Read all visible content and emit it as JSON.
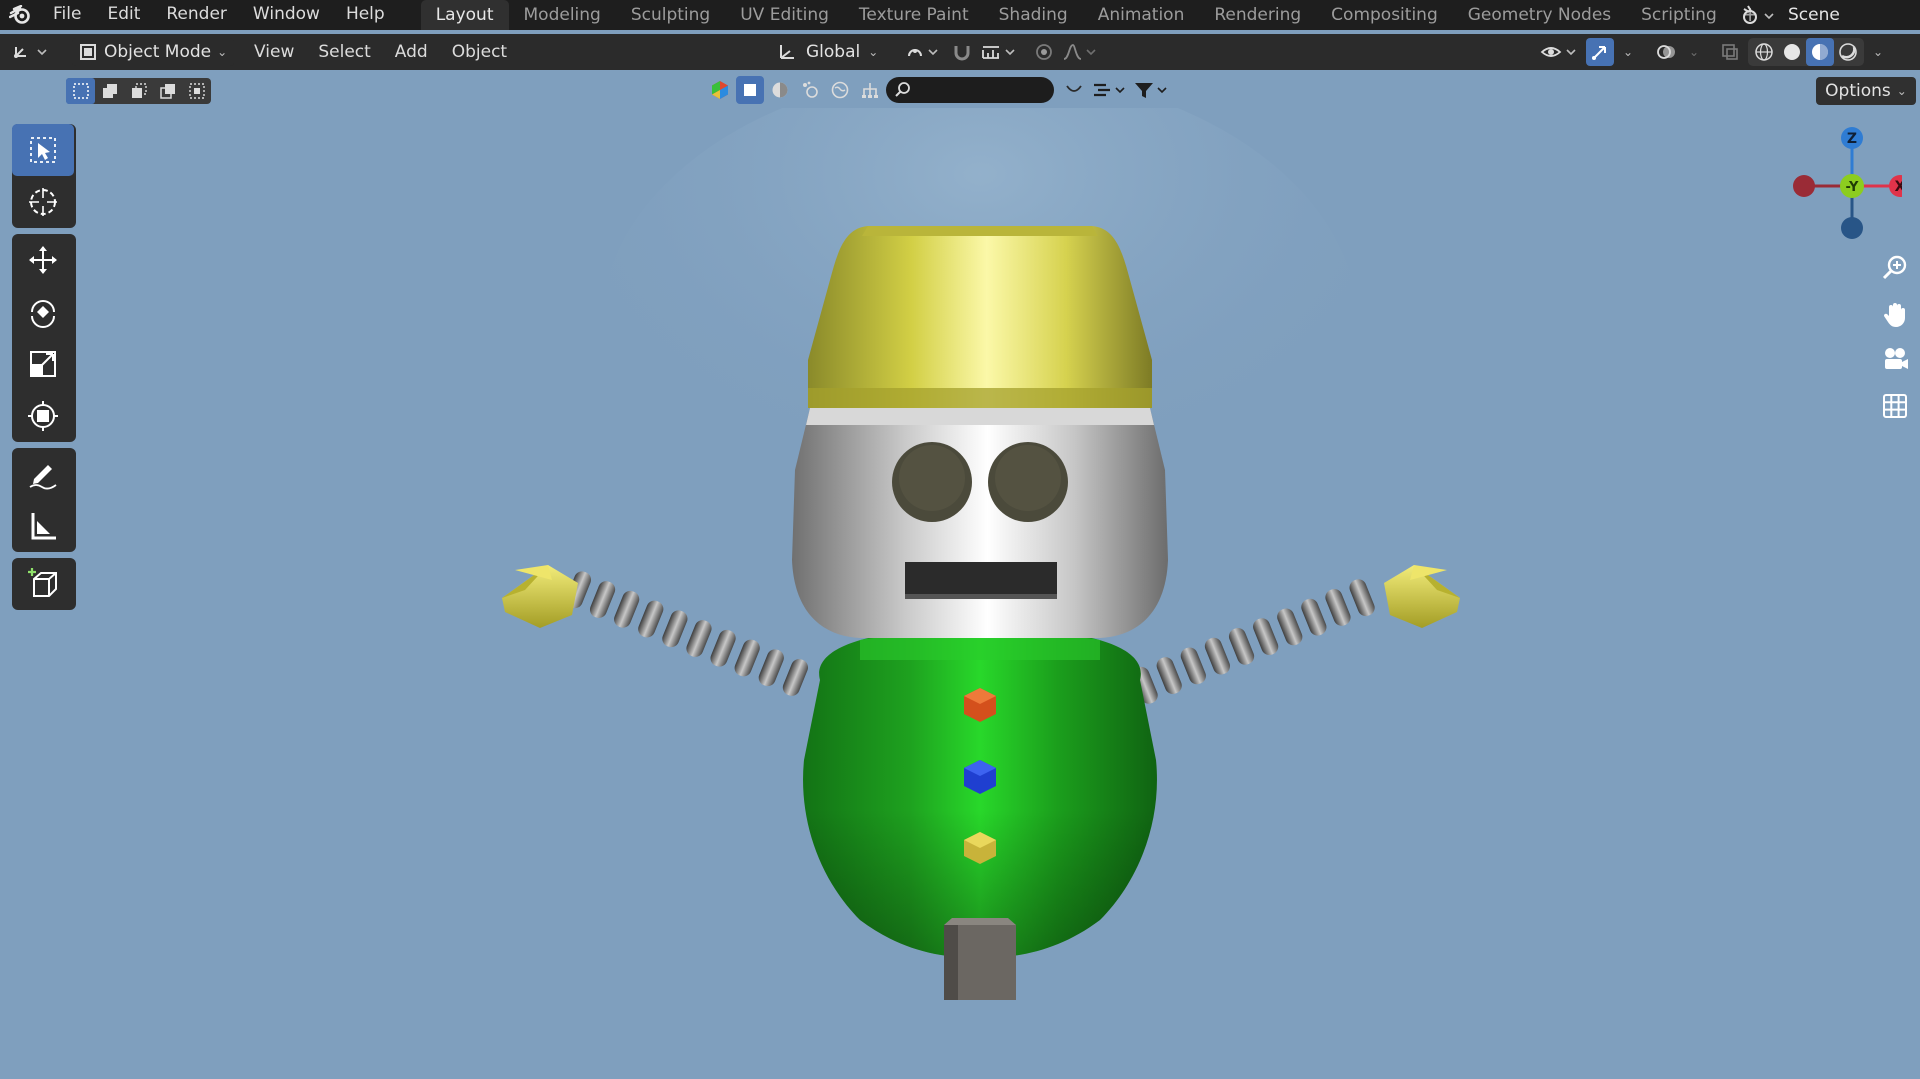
{
  "menu": {
    "items": [
      "File",
      "Edit",
      "Render",
      "Window",
      "Help"
    ]
  },
  "workspaces": {
    "tabs": [
      "Layout",
      "Modeling",
      "Sculpting",
      "UV Editing",
      "Texture Paint",
      "Shading",
      "Animation",
      "Rendering",
      "Compositing",
      "Geometry Nodes",
      "Scripting"
    ],
    "active": "Layout",
    "add_label": "+"
  },
  "scene": {
    "name": "Scene"
  },
  "header": {
    "mode": "Object Mode",
    "menus": [
      "View",
      "Select",
      "Add",
      "Object"
    ],
    "orientation": "Global"
  },
  "toolbar_row": {
    "search_placeholder": "",
    "options_label": "Options"
  },
  "tools": {
    "active": "select-box",
    "items": [
      "select-box",
      "cursor",
      "move",
      "rotate",
      "scale",
      "transform",
      "annotate",
      "measure",
      "add-cube"
    ]
  },
  "gizmo": {
    "z_label": "Z",
    "y_label": "-Y",
    "x_label": "X",
    "colors": {
      "x": "#e0334a",
      "y": "#8ccd1f",
      "z": "#2f7cd3",
      "neg_x": "#9a2b36",
      "neg_z": "#285587"
    }
  },
  "viewport": {
    "background": "#7f9fbe",
    "viewport_shading_active": "solid"
  },
  "colors": {
    "accent": "#4772b3",
    "robot_hat": "#d6d24f",
    "robot_body": "#22b624",
    "button_top": "#d4501c",
    "button_mid": "#1f3fd0",
    "button_bottom": "#c8b33a"
  }
}
